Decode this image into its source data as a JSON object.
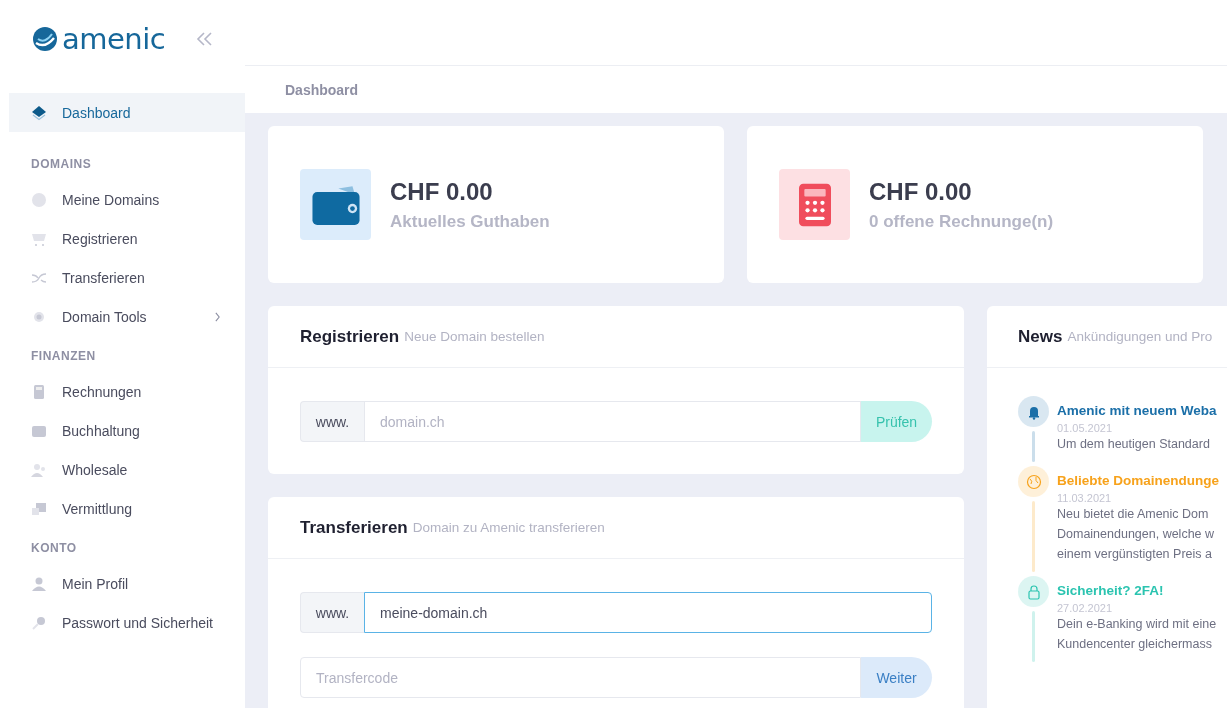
{
  "sidebar": {
    "logo": "amenic",
    "dashboard": {
      "label": "Dashboard",
      "selected": true
    },
    "sections": [
      {
        "heading": "DOMAINS",
        "items": [
          {
            "label": "Meine Domains",
            "selected": false,
            "expandable": false
          },
          {
            "label": "Registrieren",
            "selected": false,
            "expandable": false
          },
          {
            "label": "Transferieren",
            "selected": false,
            "expandable": false
          },
          {
            "label": "Domain Tools",
            "selected": false,
            "expandable": true
          }
        ]
      },
      {
        "heading": "FINANZEN",
        "items": [
          {
            "label": "Rechnungen",
            "selected": false,
            "expandable": false
          },
          {
            "label": "Buchhaltung",
            "selected": false,
            "expandable": false
          },
          {
            "label": "Wholesale",
            "selected": false,
            "expandable": false
          },
          {
            "label": "Vermittlung",
            "selected": false,
            "expandable": false
          }
        ]
      },
      {
        "heading": "KONTO",
        "items": [
          {
            "label": "Mein Profil",
            "selected": false,
            "expandable": false
          },
          {
            "label": "Passwort und Sicherheit",
            "selected": false,
            "expandable": false
          }
        ]
      }
    ]
  },
  "breadcrumb": "Dashboard",
  "stats": [
    {
      "value": "CHF 0.00",
      "label": "Aktuelles Guthaben"
    },
    {
      "value": "CHF 0.00",
      "label": "0 offene Rechnunge(n)"
    }
  ],
  "register": {
    "title": "Registrieren",
    "subtitle": "Neue Domain bestellen",
    "prefix": "www.",
    "placeholder": "domain.ch",
    "button": "Prüfen"
  },
  "transfer": {
    "title": "Transferieren",
    "subtitle": "Domain zu Amenic transferieren",
    "prefix": "www.",
    "value": "meine-domain.ch",
    "focused": true,
    "code_placeholder": "Transfercode",
    "button": "Weiter"
  },
  "news": {
    "title": "News",
    "subtitle": "Ankündigungen und Pro",
    "items": [
      {
        "title": "Amenic mit neuem Weba",
        "date": "01.05.2021",
        "lines": [
          "Um dem heutigen Standard"
        ],
        "color": "#1b6fa8"
      },
      {
        "title": "Beliebte Domainendunge",
        "date": "11.03.2021",
        "lines": [
          "Neu bietet die Amenic Dom",
          "Domainendungen, welche w",
          "einem vergünstigten Preis a"
        ],
        "color": "#f7a21b"
      },
      {
        "title": "Sicherheit? 2FA!",
        "date": "27.02.2021",
        "lines": [
          "Dein e-Banking wird mit eine",
          "Kundencenter gleichermass"
        ],
        "color": "#2bc4b0"
      }
    ]
  }
}
